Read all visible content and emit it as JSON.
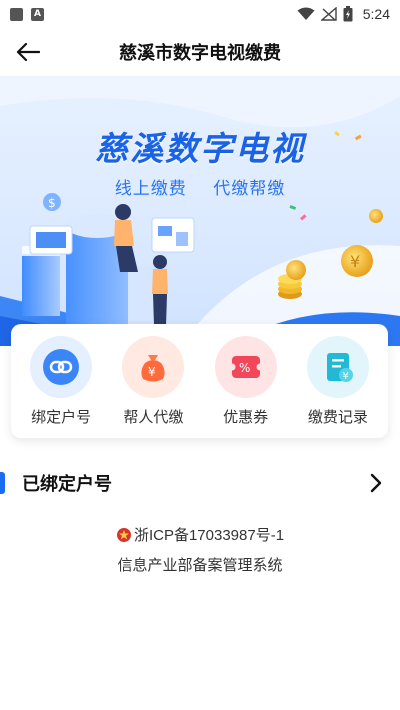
{
  "status_bar": {
    "time": "5:24",
    "left_icons": [
      "square-notification-icon",
      "a-notification-icon"
    ],
    "right_icons": [
      "wifi-icon",
      "no-signal-icon",
      "battery-icon"
    ]
  },
  "nav": {
    "title": "慈溪市数字电视缴费",
    "back_icon": "arrow-left-icon"
  },
  "banner": {
    "title": "慈溪数字电视",
    "subtitle_left": "线上缴费",
    "subtitle_right": "代缴帮缴",
    "accent_color": "#1a62e6"
  },
  "features": [
    {
      "label": "绑定户号",
      "icon": "link-icon"
    },
    {
      "label": "帮人代缴",
      "icon": "money-bag-icon"
    },
    {
      "label": "优惠券",
      "icon": "coupon-icon"
    },
    {
      "label": "缴费记录",
      "icon": "payment-record-icon"
    }
  ],
  "bound_accounts": {
    "title": "已绑定户号",
    "chevron_icon": "chevron-right-icon"
  },
  "footer": {
    "icp": "浙ICP备17033987号-1",
    "system": "信息产业部备案管理系统"
  }
}
